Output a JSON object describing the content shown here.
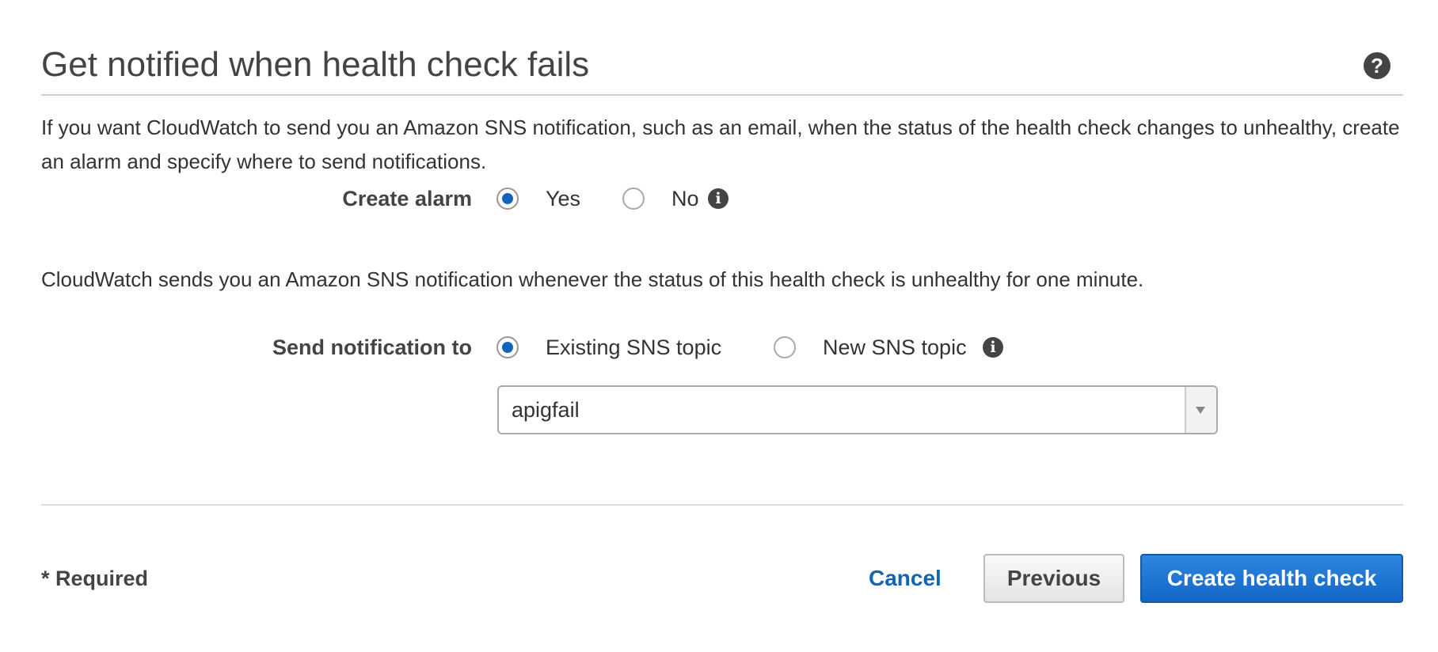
{
  "section": {
    "title": "Get notified when health check fails",
    "help_icon": "question-circle-icon",
    "intro": "If you want CloudWatch to send you an Amazon SNS notification, such as an email, when the status of the health check changes to unhealthy, create an alarm and specify where to send notifications."
  },
  "create_alarm": {
    "label": "Create alarm",
    "options": [
      {
        "label": "Yes",
        "selected": true
      },
      {
        "label": "No",
        "selected": false
      }
    ],
    "info_icon": "info-circle-icon"
  },
  "description": "CloudWatch sends you an Amazon SNS notification whenever the status of this health check is unhealthy for one minute.",
  "send_notification": {
    "label": "Send notification to",
    "options": [
      {
        "label": "Existing SNS topic",
        "selected": true
      },
      {
        "label": "New SNS topic",
        "selected": false
      }
    ],
    "info_icon": "info-circle-icon",
    "topic_select": {
      "value": "apigfail",
      "arrow_icon": "caret-down-icon"
    }
  },
  "footer": {
    "required_note": "* Required",
    "cancel_label": "Cancel",
    "previous_label": "Previous",
    "create_label": "Create health check"
  },
  "colors": {
    "accent": "#1166bb",
    "link": "#0f66b9",
    "primary_button": "#1a73d0",
    "text": "#333333"
  }
}
